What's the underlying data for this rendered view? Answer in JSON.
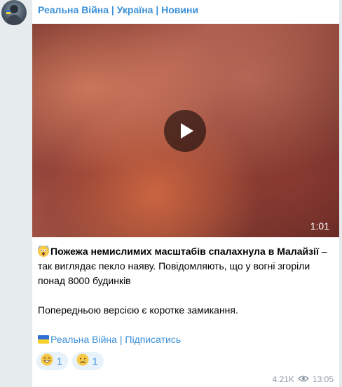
{
  "channel": {
    "name": "Реальна Війна | Україна | Новини"
  },
  "video": {
    "duration": "1:01",
    "play_icon": "play-icon"
  },
  "post": {
    "headline": "Пожежа немислимих масштабів спалахнула в Малайзії",
    "body": " – так виглядає пекло наяву. Повідомляють, що у вогні згоріли понад 8000 будинків",
    "note": "Попередньою версією є коротке замикання.",
    "footer_name": "Реальна Війна",
    "footer_sep": " | ",
    "footer_subscribe": "Підписатись"
  },
  "reactions": [
    {
      "icon": "grinning-face-icon",
      "count": "1"
    },
    {
      "icon": "crying-face-icon",
      "count": "1"
    }
  ],
  "meta": {
    "views": "4.21K",
    "time": "13:05"
  },
  "colors": {
    "accent": "#3a8fd6",
    "background": "#e6ebee"
  }
}
